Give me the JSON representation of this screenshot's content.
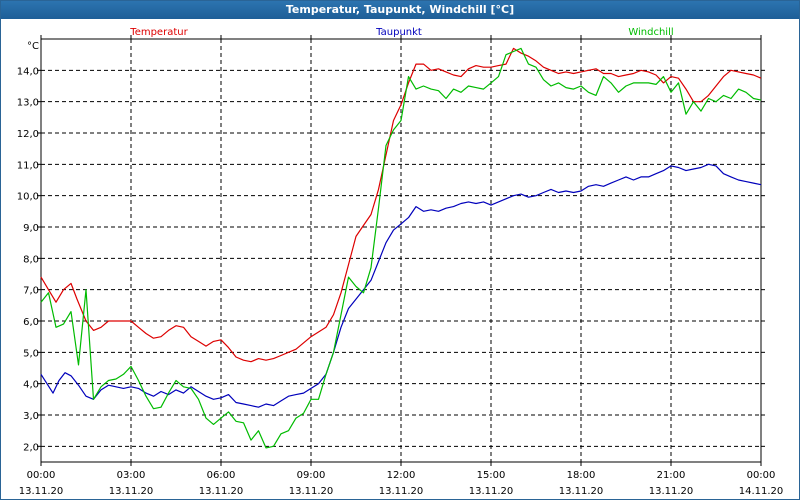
{
  "window": {
    "title": "Temperatur, Taupunkt, Windchill [°C]"
  },
  "colors": {
    "temperatur": "#dd0000",
    "taupunkt": "#0000bb",
    "windchill": "#00bb00",
    "grid": "#000000"
  },
  "chart_data": {
    "type": "line",
    "title": "Temperatur, Taupunkt, Windchill [°C]",
    "ylabel": "°C",
    "ylim": [
      1.5,
      15.0
    ],
    "y_ticks": [
      2.0,
      3.0,
      4.0,
      5.0,
      6.0,
      7.0,
      8.0,
      9.0,
      10.0,
      11.0,
      12.0,
      13.0,
      14.0
    ],
    "y_tick_labels": [
      "2,0",
      "3,0",
      "4,0",
      "5,0",
      "6,0",
      "7,0",
      "8,0",
      "9,0",
      "10,0",
      "11,0",
      "12,0",
      "13,0",
      "14,0"
    ],
    "xlim_hours": [
      0,
      24
    ],
    "x_ticks": [
      {
        "time": "00:00",
        "date": "13.11.20"
      },
      {
        "time": "03:00",
        "date": "13.11.20"
      },
      {
        "time": "06:00",
        "date": "13.11.20"
      },
      {
        "time": "09:00",
        "date": "13.11.20"
      },
      {
        "time": "12:00",
        "date": "13.11.20"
      },
      {
        "time": "15:00",
        "date": "13.11.20"
      },
      {
        "time": "18:00",
        "date": "13.11.20"
      },
      {
        "time": "21:00",
        "date": "13.11.20"
      },
      {
        "time": "00:00",
        "date": "14.11.20"
      }
    ],
    "grid": true,
    "legend_position": "top",
    "series": [
      {
        "name": "Temperatur",
        "color_key": "temperatur",
        "points": [
          [
            0.0,
            7.4
          ],
          [
            0.25,
            7.0
          ],
          [
            0.5,
            6.6
          ],
          [
            0.75,
            7.0
          ],
          [
            1.0,
            7.2
          ],
          [
            1.2,
            6.7
          ],
          [
            1.5,
            6.0
          ],
          [
            1.75,
            5.7
          ],
          [
            2.0,
            5.8
          ],
          [
            2.25,
            6.0
          ],
          [
            2.5,
            6.0
          ],
          [
            2.75,
            6.0
          ],
          [
            3.0,
            6.0
          ],
          [
            3.25,
            5.8
          ],
          [
            3.5,
            5.6
          ],
          [
            3.75,
            5.45
          ],
          [
            4.0,
            5.5
          ],
          [
            4.25,
            5.7
          ],
          [
            4.5,
            5.85
          ],
          [
            4.75,
            5.8
          ],
          [
            5.0,
            5.5
          ],
          [
            5.25,
            5.35
          ],
          [
            5.5,
            5.2
          ],
          [
            5.75,
            5.35
          ],
          [
            6.0,
            5.4
          ],
          [
            6.25,
            5.15
          ],
          [
            6.5,
            4.85
          ],
          [
            6.75,
            4.75
          ],
          [
            7.0,
            4.7
          ],
          [
            7.25,
            4.8
          ],
          [
            7.5,
            4.75
          ],
          [
            7.75,
            4.8
          ],
          [
            8.0,
            4.9
          ],
          [
            8.25,
            5.0
          ],
          [
            8.5,
            5.1
          ],
          [
            8.75,
            5.3
          ],
          [
            9.0,
            5.5
          ],
          [
            9.25,
            5.65
          ],
          [
            9.5,
            5.8
          ],
          [
            9.75,
            6.2
          ],
          [
            10.0,
            6.9
          ],
          [
            10.25,
            7.8
          ],
          [
            10.5,
            8.7
          ],
          [
            10.75,
            9.05
          ],
          [
            11.0,
            9.4
          ],
          [
            11.25,
            10.2
          ],
          [
            11.5,
            11.3
          ],
          [
            11.75,
            12.4
          ],
          [
            12.0,
            12.9
          ],
          [
            12.25,
            13.6
          ],
          [
            12.5,
            14.2
          ],
          [
            12.75,
            14.2
          ],
          [
            13.0,
            14.0
          ],
          [
            13.25,
            14.05
          ],
          [
            13.5,
            13.95
          ],
          [
            13.75,
            13.85
          ],
          [
            14.0,
            13.8
          ],
          [
            14.25,
            14.05
          ],
          [
            14.5,
            14.15
          ],
          [
            14.75,
            14.1
          ],
          [
            15.0,
            14.1
          ],
          [
            15.25,
            14.15
          ],
          [
            15.5,
            14.2
          ],
          [
            15.75,
            14.7
          ],
          [
            16.0,
            14.55
          ],
          [
            16.25,
            14.45
          ],
          [
            16.5,
            14.3
          ],
          [
            16.75,
            14.1
          ],
          [
            17.0,
            14.0
          ],
          [
            17.25,
            13.9
          ],
          [
            17.5,
            13.95
          ],
          [
            17.75,
            13.9
          ],
          [
            18.0,
            13.95
          ],
          [
            18.25,
            14.0
          ],
          [
            18.5,
            14.05
          ],
          [
            18.75,
            13.9
          ],
          [
            19.0,
            13.9
          ],
          [
            19.25,
            13.8
          ],
          [
            19.5,
            13.85
          ],
          [
            19.75,
            13.9
          ],
          [
            20.0,
            14.0
          ],
          [
            20.25,
            13.95
          ],
          [
            20.5,
            13.85
          ],
          [
            20.75,
            13.6
          ],
          [
            21.0,
            13.8
          ],
          [
            21.25,
            13.75
          ],
          [
            21.5,
            13.4
          ],
          [
            21.75,
            13.0
          ],
          [
            22.0,
            13.0
          ],
          [
            22.25,
            13.2
          ],
          [
            22.5,
            13.5
          ],
          [
            22.75,
            13.8
          ],
          [
            23.0,
            14.0
          ],
          [
            23.25,
            13.95
          ],
          [
            23.5,
            13.9
          ],
          [
            23.75,
            13.85
          ],
          [
            24.0,
            13.75
          ]
        ]
      },
      {
        "name": "Taupunkt",
        "color_key": "taupunkt",
        "points": [
          [
            0.0,
            4.3
          ],
          [
            0.2,
            4.0
          ],
          [
            0.4,
            3.7
          ],
          [
            0.6,
            4.1
          ],
          [
            0.8,
            4.35
          ],
          [
            1.0,
            4.25
          ],
          [
            1.25,
            3.95
          ],
          [
            1.5,
            3.6
          ],
          [
            1.75,
            3.5
          ],
          [
            2.0,
            3.8
          ],
          [
            2.25,
            3.95
          ],
          [
            2.5,
            3.9
          ],
          [
            2.75,
            3.85
          ],
          [
            3.0,
            3.9
          ],
          [
            3.25,
            3.85
          ],
          [
            3.5,
            3.7
          ],
          [
            3.75,
            3.6
          ],
          [
            4.0,
            3.75
          ],
          [
            4.25,
            3.65
          ],
          [
            4.5,
            3.8
          ],
          [
            4.75,
            3.7
          ],
          [
            5.0,
            3.9
          ],
          [
            5.25,
            3.75
          ],
          [
            5.5,
            3.6
          ],
          [
            5.75,
            3.5
          ],
          [
            6.0,
            3.55
          ],
          [
            6.25,
            3.65
          ],
          [
            6.5,
            3.4
          ],
          [
            6.75,
            3.35
          ],
          [
            7.0,
            3.3
          ],
          [
            7.25,
            3.25
          ],
          [
            7.5,
            3.35
          ],
          [
            7.75,
            3.3
          ],
          [
            8.0,
            3.45
          ],
          [
            8.25,
            3.6
          ],
          [
            8.5,
            3.65
          ],
          [
            8.75,
            3.7
          ],
          [
            9.0,
            3.85
          ],
          [
            9.25,
            4.0
          ],
          [
            9.5,
            4.3
          ],
          [
            9.75,
            5.0
          ],
          [
            10.0,
            5.8
          ],
          [
            10.25,
            6.4
          ],
          [
            10.5,
            6.7
          ],
          [
            10.75,
            7.0
          ],
          [
            11.0,
            7.3
          ],
          [
            11.25,
            7.9
          ],
          [
            11.5,
            8.5
          ],
          [
            11.75,
            8.9
          ],
          [
            12.0,
            9.1
          ],
          [
            12.25,
            9.3
          ],
          [
            12.5,
            9.65
          ],
          [
            12.75,
            9.5
          ],
          [
            13.0,
            9.55
          ],
          [
            13.25,
            9.5
          ],
          [
            13.5,
            9.6
          ],
          [
            13.75,
            9.65
          ],
          [
            14.0,
            9.75
          ],
          [
            14.25,
            9.8
          ],
          [
            14.5,
            9.75
          ],
          [
            14.75,
            9.8
          ],
          [
            15.0,
            9.7
          ],
          [
            15.25,
            9.8
          ],
          [
            15.5,
            9.9
          ],
          [
            15.75,
            10.0
          ],
          [
            16.0,
            10.05
          ],
          [
            16.25,
            9.95
          ],
          [
            16.5,
            10.0
          ],
          [
            16.75,
            10.1
          ],
          [
            17.0,
            10.2
          ],
          [
            17.25,
            10.1
          ],
          [
            17.5,
            10.15
          ],
          [
            17.75,
            10.1
          ],
          [
            18.0,
            10.15
          ],
          [
            18.25,
            10.3
          ],
          [
            18.5,
            10.35
          ],
          [
            18.75,
            10.3
          ],
          [
            19.0,
            10.4
          ],
          [
            19.25,
            10.5
          ],
          [
            19.5,
            10.6
          ],
          [
            19.75,
            10.5
          ],
          [
            20.0,
            10.6
          ],
          [
            20.25,
            10.6
          ],
          [
            20.5,
            10.7
          ],
          [
            20.75,
            10.8
          ],
          [
            21.0,
            10.95
          ],
          [
            21.25,
            10.9
          ],
          [
            21.5,
            10.8
          ],
          [
            21.75,
            10.85
          ],
          [
            22.0,
            10.9
          ],
          [
            22.25,
            11.0
          ],
          [
            22.5,
            10.95
          ],
          [
            22.75,
            10.7
          ],
          [
            23.0,
            10.6
          ],
          [
            23.25,
            10.5
          ],
          [
            23.5,
            10.45
          ],
          [
            23.75,
            10.4
          ],
          [
            24.0,
            10.35
          ]
        ]
      },
      {
        "name": "Windchill",
        "color_key": "windchill",
        "points": [
          [
            0.0,
            6.6
          ],
          [
            0.25,
            6.9
          ],
          [
            0.5,
            5.8
          ],
          [
            0.75,
            5.9
          ],
          [
            1.0,
            6.3
          ],
          [
            1.25,
            4.6
          ],
          [
            1.5,
            7.0
          ],
          [
            1.75,
            3.5
          ],
          [
            2.0,
            3.9
          ],
          [
            2.25,
            4.1
          ],
          [
            2.5,
            4.15
          ],
          [
            2.75,
            4.3
          ],
          [
            3.0,
            4.55
          ],
          [
            3.25,
            4.1
          ],
          [
            3.5,
            3.6
          ],
          [
            3.75,
            3.2
          ],
          [
            4.0,
            3.25
          ],
          [
            4.25,
            3.7
          ],
          [
            4.5,
            4.1
          ],
          [
            4.75,
            3.9
          ],
          [
            5.0,
            3.85
          ],
          [
            5.25,
            3.5
          ],
          [
            5.5,
            2.9
          ],
          [
            5.75,
            2.7
          ],
          [
            6.0,
            2.9
          ],
          [
            6.25,
            3.1
          ],
          [
            6.5,
            2.8
          ],
          [
            6.75,
            2.75
          ],
          [
            7.0,
            2.2
          ],
          [
            7.25,
            2.5
          ],
          [
            7.5,
            1.95
          ],
          [
            7.75,
            2.0
          ],
          [
            8.0,
            2.4
          ],
          [
            8.25,
            2.5
          ],
          [
            8.5,
            2.9
          ],
          [
            8.75,
            3.05
          ],
          [
            9.0,
            3.5
          ],
          [
            9.25,
            3.5
          ],
          [
            9.5,
            4.3
          ],
          [
            9.75,
            5.0
          ],
          [
            10.0,
            6.2
          ],
          [
            10.25,
            7.4
          ],
          [
            10.5,
            7.1
          ],
          [
            10.75,
            6.9
          ],
          [
            11.0,
            7.7
          ],
          [
            11.25,
            9.6
          ],
          [
            11.5,
            11.6
          ],
          [
            11.75,
            12.1
          ],
          [
            12.0,
            12.4
          ],
          [
            12.25,
            13.8
          ],
          [
            12.5,
            13.4
          ],
          [
            12.75,
            13.5
          ],
          [
            13.0,
            13.4
          ],
          [
            13.25,
            13.35
          ],
          [
            13.5,
            13.1
          ],
          [
            13.75,
            13.4
          ],
          [
            14.0,
            13.3
          ],
          [
            14.25,
            13.5
          ],
          [
            14.5,
            13.45
          ],
          [
            14.75,
            13.4
          ],
          [
            15.0,
            13.6
          ],
          [
            15.25,
            13.8
          ],
          [
            15.5,
            14.5
          ],
          [
            15.75,
            14.6
          ],
          [
            16.0,
            14.7
          ],
          [
            16.25,
            14.2
          ],
          [
            16.5,
            14.1
          ],
          [
            16.75,
            13.7
          ],
          [
            17.0,
            13.5
          ],
          [
            17.25,
            13.6
          ],
          [
            17.5,
            13.45
          ],
          [
            17.75,
            13.4
          ],
          [
            18.0,
            13.5
          ],
          [
            18.25,
            13.3
          ],
          [
            18.5,
            13.2
          ],
          [
            18.75,
            13.8
          ],
          [
            19.0,
            13.6
          ],
          [
            19.25,
            13.3
          ],
          [
            19.5,
            13.5
          ],
          [
            19.75,
            13.6
          ],
          [
            20.0,
            13.6
          ],
          [
            20.25,
            13.6
          ],
          [
            20.5,
            13.55
          ],
          [
            20.75,
            13.8
          ],
          [
            21.0,
            13.3
          ],
          [
            21.25,
            13.6
          ],
          [
            21.5,
            12.6
          ],
          [
            21.75,
            13.0
          ],
          [
            22.0,
            12.7
          ],
          [
            22.25,
            13.1
          ],
          [
            22.5,
            13.0
          ],
          [
            22.75,
            13.2
          ],
          [
            23.0,
            13.1
          ],
          [
            23.25,
            13.4
          ],
          [
            23.5,
            13.3
          ],
          [
            23.75,
            13.1
          ],
          [
            24.0,
            13.05
          ]
        ]
      }
    ]
  }
}
